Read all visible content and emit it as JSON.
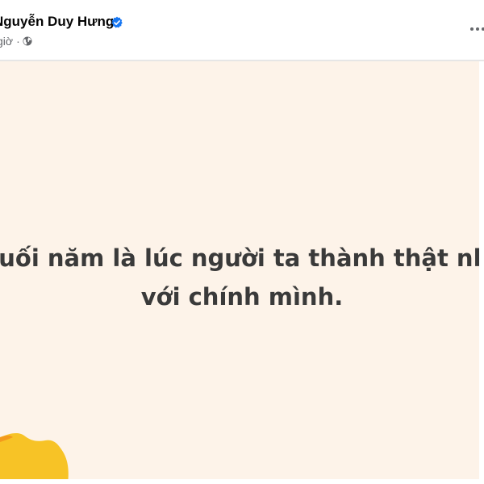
{
  "post": {
    "author": {
      "name": "Nguyễn Duy Hưng",
      "verified": true,
      "verified_icon": "verified-badge-icon",
      "badge_color": "#1877f2"
    },
    "meta": {
      "time": "giờ",
      "separator": "·",
      "audience_icon": "globe-icon"
    },
    "more_options_icon": "more-dots-icon",
    "status": {
      "line1": "Cuối năm là lúc người ta thành thật nhất",
      "line2": "với chính mình."
    },
    "background_color": "#fdf3e9",
    "accent_color": "#f7c326"
  }
}
